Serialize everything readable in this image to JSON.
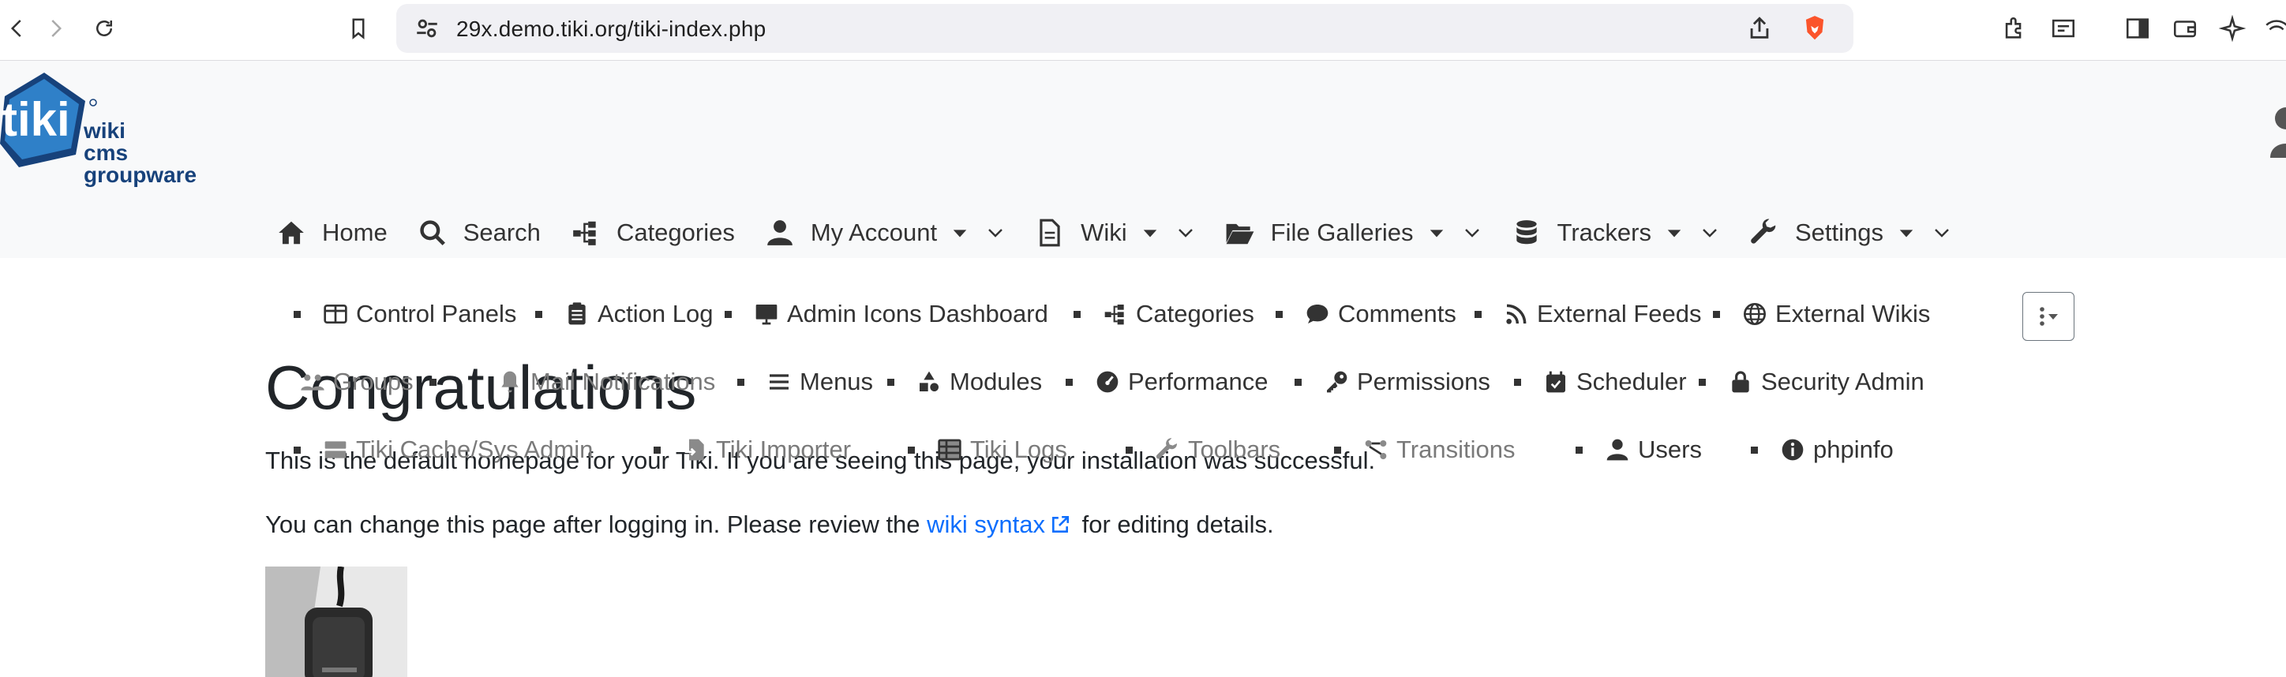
{
  "browser": {
    "url": "29x.demo.tiki.org/tiki-index.php"
  },
  "logo": {
    "mark": "tiki",
    "line1": "wiki",
    "line2": "cms",
    "line3": "groupware"
  },
  "topmenu": [
    {
      "label": "Home",
      "icon": "home-icon",
      "caret": false
    },
    {
      "label": "Search",
      "icon": "search-icon",
      "caret": false
    },
    {
      "label": "Categories",
      "icon": "sitemap-icon",
      "caret": false
    },
    {
      "label": "My Account",
      "icon": "user-icon",
      "caret": true
    },
    {
      "label": "Wiki",
      "icon": "file-icon",
      "caret": true
    },
    {
      "label": "File Galleries",
      "icon": "folder-open-icon",
      "caret": true
    },
    {
      "label": "Trackers",
      "icon": "database-icon",
      "caret": true
    },
    {
      "label": "Settings",
      "icon": "wrench-icon",
      "caret": true
    }
  ],
  "submenu": {
    "row1": [
      "Control Panels",
      "Action Log",
      "Admin Icons Dashboard",
      "Categories",
      "Comments",
      "External Feeds",
      "External Wikis"
    ],
    "row2": [
      "Groups",
      "Mail Notifications",
      "Menus",
      "Modules",
      "Performance",
      "Permissions",
      "Scheduler",
      "Security Admin"
    ],
    "row3": [
      "Tiki Cache/Sys Admin",
      "Tiki Importer",
      "Tiki Logs",
      "Toolbars",
      "Transitions",
      "Users",
      "phpinfo"
    ]
  },
  "content": {
    "title": "Congratulations",
    "para1": "This is the default homepage for your Tiki. If you are seeing this page, your installation was successful.",
    "para2_before": "You can change this page after logging in. Please review the ",
    "para2_link": "wiki syntax",
    "para2_after": " for editing details."
  },
  "colors": {
    "link": "#0d6efd",
    "tiki_blue": "#17427b",
    "header_bg": "#f8f9fa"
  }
}
